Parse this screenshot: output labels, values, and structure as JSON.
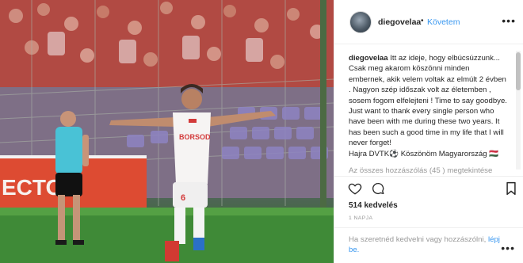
{
  "post": {
    "username": "diegovelaa",
    "separator": "•",
    "follow_label": "Követem",
    "more_label": "•••"
  },
  "caption": {
    "username": "diegovelaa",
    "text": "Itt az ideje, hogy elbúcsúzzunk... Csak meg akarom köszönni minden embernek, akik velem voltak az elmúlt 2 évben . Nagyon szép időszak volt az életemben , sosem fogom elfelejteni ! Time to say goodbye. Just want to thank every single person who have been with me during these two years. It has been such a good time in my life that I will never forget!",
    "hashtag_line": "Hajra DVTK⚽ Köszönöm Magyarország 🇭🇺"
  },
  "comments": {
    "view_all": "Az összes hozzászólás (45 ) megtekintése"
  },
  "stats": {
    "likes": "514 kedvelés",
    "time": "1 NAPJA"
  },
  "footer": {
    "prompt": "Ha szeretnéd kedvelni vagy hozzászólni,",
    "login_link": "lépj be."
  },
  "photo": {
    "board_text": "ECTOR",
    "jersey_text": "BORSOD",
    "jersey_number": "6"
  },
  "icons": {
    "like": "heart-icon",
    "comment": "comment-icon",
    "save": "bookmark-icon",
    "more": "more-options-icon"
  },
  "colors": {
    "link_blue": "#3897f0",
    "text": "#262626",
    "muted": "#999999"
  }
}
